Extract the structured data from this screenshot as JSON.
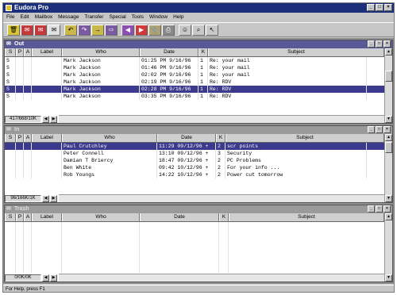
{
  "window": {
    "title": "Eudora Pro",
    "buttons": [
      "_",
      "□",
      "×"
    ]
  },
  "menu": [
    "File",
    "Edit",
    "Mailbox",
    "Message",
    "Transfer",
    "Special",
    "Tools",
    "Window",
    "Help"
  ],
  "toolbar": {
    "icons": [
      "trash-icon",
      "mailbox-in-icon",
      "mailbox-out-icon",
      "mail-icon",
      "reply-icon",
      "reply-all-icon",
      "forward-icon",
      "redirect-icon",
      "prev-message-icon",
      "next-message-icon",
      "attach-icon",
      "print-icon",
      "nickname-icon",
      "search-icon",
      "help-cursor-icon"
    ],
    "glyphs": [
      "🗑",
      "✉",
      "✉",
      "✉",
      "↶",
      "↷",
      "→",
      "⇨",
      "◀",
      "▶",
      "📎",
      "⎙",
      "☺",
      "⌕",
      "↖"
    ]
  },
  "out_mailbox": {
    "title": "Out",
    "columns": [
      "S",
      "P",
      "A",
      "Label",
      "Who",
      "Date",
      "K",
      "Subject"
    ],
    "rows": [
      {
        "status": "S",
        "who": "Mark Jackson",
        "date": "01:25 PM 9/16/96",
        "k": "1",
        "subject": "Re: your mail"
      },
      {
        "status": "S",
        "who": "Mark Jackson",
        "date": "01:46 PM 9/16/96",
        "k": "1",
        "subject": "Re: your mail"
      },
      {
        "status": "S",
        "who": "Mark Jackson",
        "date": "02:02 PM 9/16/96",
        "k": "1",
        "subject": "Re: your mail"
      },
      {
        "status": "S",
        "who": "Mark Jackson",
        "date": "02:19 PM 9/16/96",
        "k": "1",
        "subject": "Re: RDV"
      },
      {
        "status": "S",
        "who": "Mark Jackson",
        "date": "02:28 PM 9/16/96",
        "k": "1",
        "subject": "Re: RDV"
      },
      {
        "status": "S",
        "who": "Mark Jackson",
        "date": "03:35 PM 9/16/96",
        "k": "1",
        "subject": "Re: RDV"
      }
    ],
    "count": "417/668/10K"
  },
  "in_mailbox": {
    "title": "In",
    "columns": [
      "S",
      "P",
      "A",
      "Label",
      "Who",
      "Date",
      "K",
      "Subject"
    ],
    "rows": [
      {
        "status": "",
        "who": "Paul Crutchley",
        "date": "11:29 09/12/96 +",
        "k": "2",
        "subject": "scr points"
      },
      {
        "status": "",
        "who": "Peter Connell",
        "date": "13:10 09/12/96 +",
        "k": "3",
        "subject": "Security"
      },
      {
        "status": "",
        "who": "Damian T Briercy",
        "date": "18:47 09/12/96 +",
        "k": "2",
        "subject": "PC Problems"
      },
      {
        "status": "",
        "who": "Ben White",
        "date": "09:42 10/12/96 +",
        "k": "2",
        "subject": "For your info ..."
      },
      {
        "status": "",
        "who": "Rob Youngs",
        "date": "14:22 10/12/96 +",
        "k": "2",
        "subject": "Power cut tomorrow"
      }
    ],
    "count": "96/166K/1K"
  },
  "trash_mailbox": {
    "title": "Trash",
    "columns": [
      "S",
      "P",
      "A",
      "Label",
      "Who",
      "Date",
      "K",
      "Subject"
    ],
    "count": "0/0K/0K"
  },
  "statusbar": {
    "text": "For Help, press F1"
  }
}
